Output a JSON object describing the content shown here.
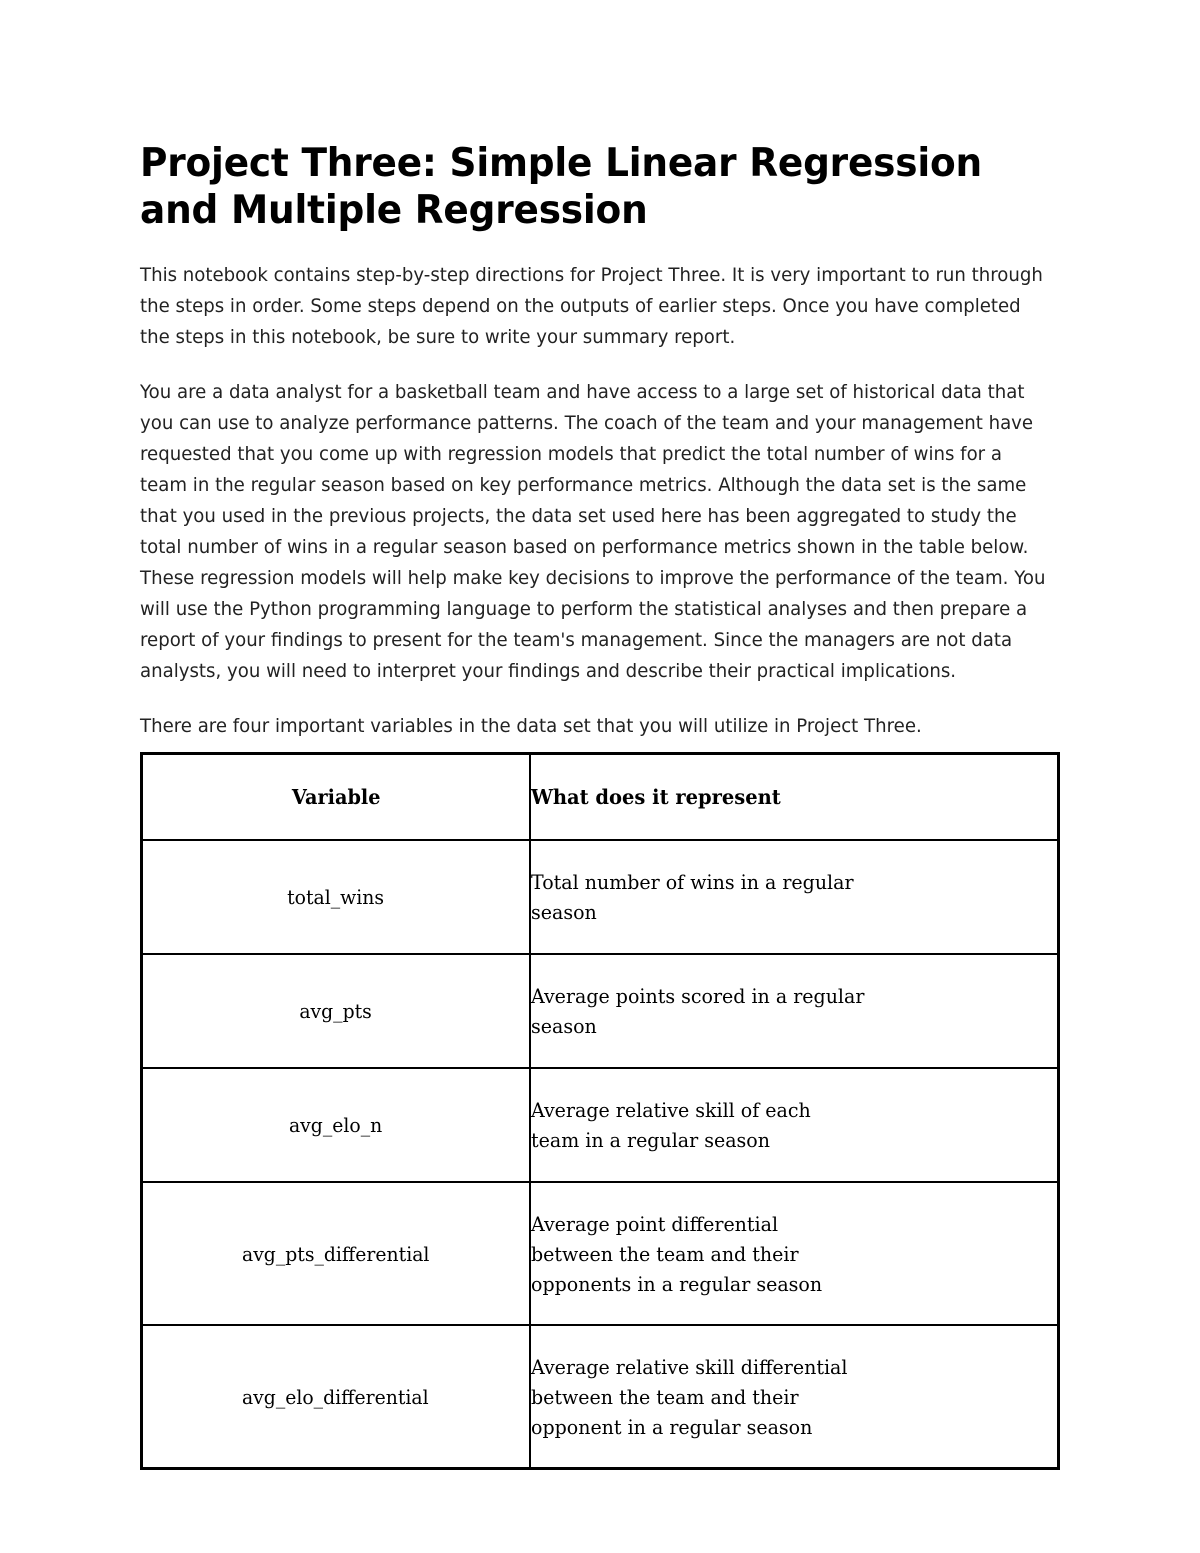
{
  "document": {
    "title": "Project Three: Simple Linear Regression and Multiple Regression",
    "paragraphs": [
      "This notebook contains step-by-step directions for Project Three. It is very important to run through the steps in order. Some steps depend on the outputs of earlier steps. Once you have completed the steps in this notebook, be sure to write your summary report.",
      "You are a data analyst for a basketball team and have access to a large set of historical data that you can use to analyze performance patterns. The coach of the team and your management have requested that you come up with regression models that predict the total number of wins for a team in the regular season based on key performance metrics. Although the data set is the same that you used in the previous projects, the data set used here has been aggregated to study the total number of wins in a regular season based on performance metrics shown in the table below. These regression models will help make key decisions to improve the performance of the team. You will use the Python programming language to perform the statistical analyses and then prepare a report of your findings to present for the team's management. Since the managers are not data analysts, you will need to interpret your findings and describe their practical implications."
    ],
    "table_intro": "There are four important variables in the data set that you will utilize in Project Three."
  },
  "variables_table": {
    "headers": {
      "variable": "Variable",
      "represents": "What does it represent"
    },
    "rows": [
      {
        "variable": "total_wins",
        "description_lines": [
          "Total number of wins in a regular",
          "season"
        ]
      },
      {
        "variable": "avg_pts",
        "description_lines": [
          "Average points scored in a regular",
          "season"
        ]
      },
      {
        "variable": "avg_elo_n",
        "description_lines": [
          "Average relative skill of each",
          "team in a regular season"
        ]
      },
      {
        "variable": "avg_pts_differential",
        "description_lines": [
          "Average point differential",
          "between the team and their",
          "opponents in a regular season"
        ]
      },
      {
        "variable": "avg_elo_differential",
        "description_lines": [
          "Average relative skill differential",
          "between the team and their",
          "opponent in a regular season"
        ]
      }
    ]
  },
  "colors": {
    "page_background": "#ffffff",
    "body_text": "#222222",
    "heading_text": "#000000",
    "table_border": "#000000"
  }
}
